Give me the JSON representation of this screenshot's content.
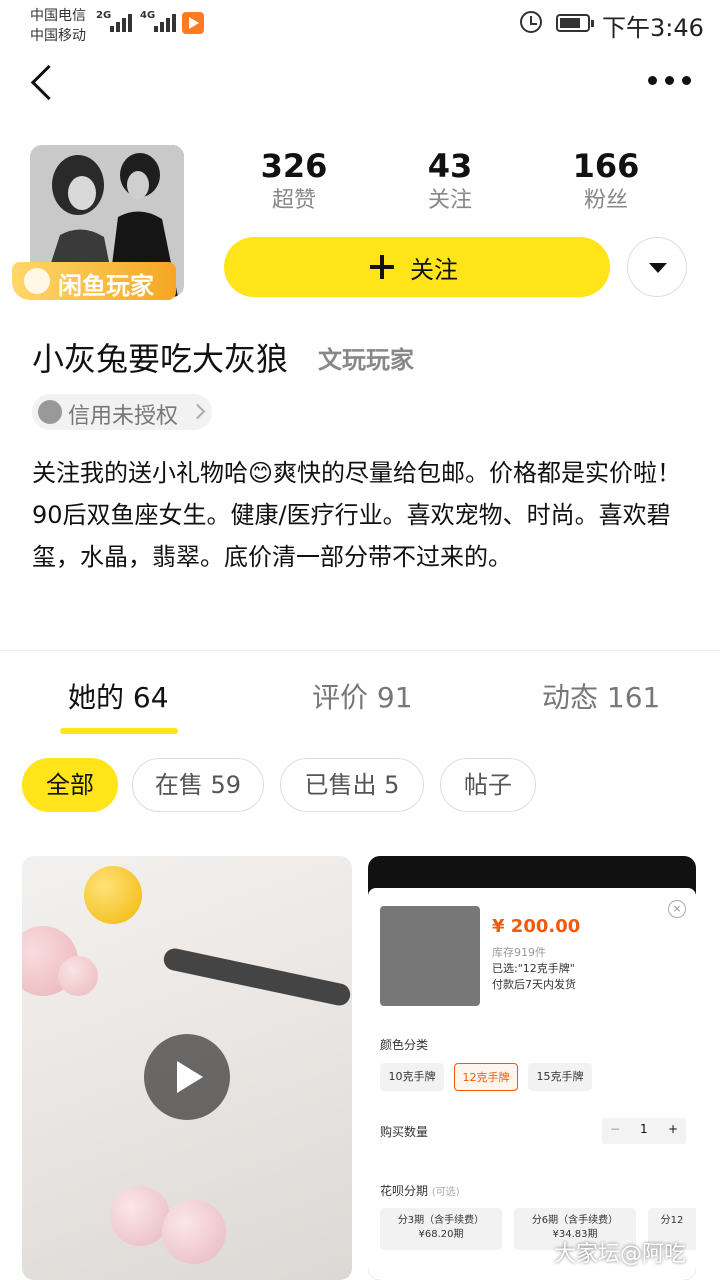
{
  "status_bar": {
    "carrier1": "中国电信",
    "carrier2": "中国移动",
    "net1": "2G",
    "net2": "4G",
    "time": "下午3:46"
  },
  "profile": {
    "badge": "闲鱼玩家",
    "stats": [
      {
        "value": "326",
        "label": "超赞"
      },
      {
        "value": "43",
        "label": "关注"
      },
      {
        "value": "166",
        "label": "粉丝"
      }
    ],
    "follow_label": "关注",
    "username": "小灰兔要吃大灰狼",
    "user_tag": "文玩玩家",
    "credit": "信用未授权",
    "bio": "关注我的送小礼物哈😊爽快的尽量给包邮。价格都是实价啦！90后双鱼座女生。健康/医疗行业。喜欢宠物、时尚。喜欢碧玺，水晶，翡翠。底价清一部分带不过来的。"
  },
  "tabs": [
    {
      "label": "她的 64",
      "active": true
    },
    {
      "label": "评价 91",
      "active": false
    },
    {
      "label": "动态 161",
      "active": false
    }
  ],
  "filters": [
    {
      "label": "全部",
      "active": true
    },
    {
      "label": "在售 59",
      "active": false
    },
    {
      "label": "已售出 5",
      "active": false
    },
    {
      "label": "帖子",
      "active": false
    }
  ],
  "card_right": {
    "price": "¥ 200.00",
    "stock": "库存919件",
    "selected": "已选:\"12克手牌\"",
    "ship": "付款后7天内发货",
    "color_section": "颜色分类",
    "options": [
      "10克手牌",
      "12克手牌",
      "15克手牌"
    ],
    "qty_section": "购买数量",
    "qty_minus": "−",
    "qty_value": "1",
    "qty_plus": "+",
    "install_section": "花呗分期",
    "install_note": "(可选)",
    "installments": [
      {
        "title": "分3期（含手续费）",
        "amount": "¥68.20期"
      },
      {
        "title": "分6期（含手续费）",
        "amount": "¥34.83期"
      },
      {
        "title": "分12",
        "amount": ""
      }
    ]
  },
  "watermark": "大家坛@阿吃",
  "colors": {
    "accent_yellow": "#ffe41a",
    "price_orange": "#f25a0a"
  }
}
